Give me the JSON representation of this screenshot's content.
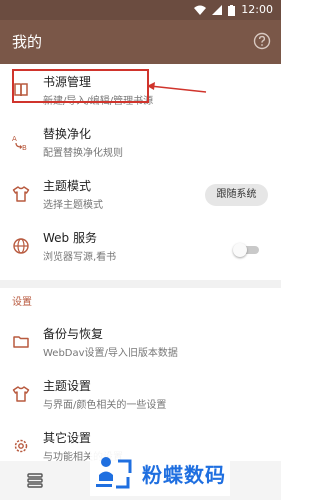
{
  "status_bar": {
    "time": "12:00"
  },
  "app_bar": {
    "title": "我的"
  },
  "menu_items": [
    {
      "title": "书源管理",
      "subtitle": "新建/导入/编辑/管理书源"
    },
    {
      "title": "替换净化",
      "subtitle": "配置替换净化规则"
    },
    {
      "title": "主题模式",
      "subtitle": "选择主题模式",
      "action_label": "跟随系统"
    },
    {
      "title": "Web 服务",
      "subtitle": "浏览器写源,看书",
      "toggle_on": false
    }
  ],
  "settings": {
    "header": "设置",
    "items": [
      {
        "title": "备份与恢复",
        "subtitle": "WebDav设置/导入旧版本数据"
      },
      {
        "title": "主题设置",
        "subtitle": "与界面/颜色相关的一些设置"
      },
      {
        "title": "其它设置",
        "subtitle": "与功能相关的设置"
      }
    ]
  },
  "watermark": {
    "text": "粉蝶数码"
  },
  "colors": {
    "status_bar": "#6b4c40",
    "app_bar": "#7a5748",
    "accent": "#b85a3f",
    "highlight": "#d0342c",
    "watermark": "#1f6fe0"
  },
  "icons": [
    "book-icon",
    "replace-icon",
    "tshirt-icon",
    "globe-icon",
    "folder-icon",
    "tshirt-icon",
    "gear-icon",
    "help-icon",
    "bookshelf-icon"
  ]
}
